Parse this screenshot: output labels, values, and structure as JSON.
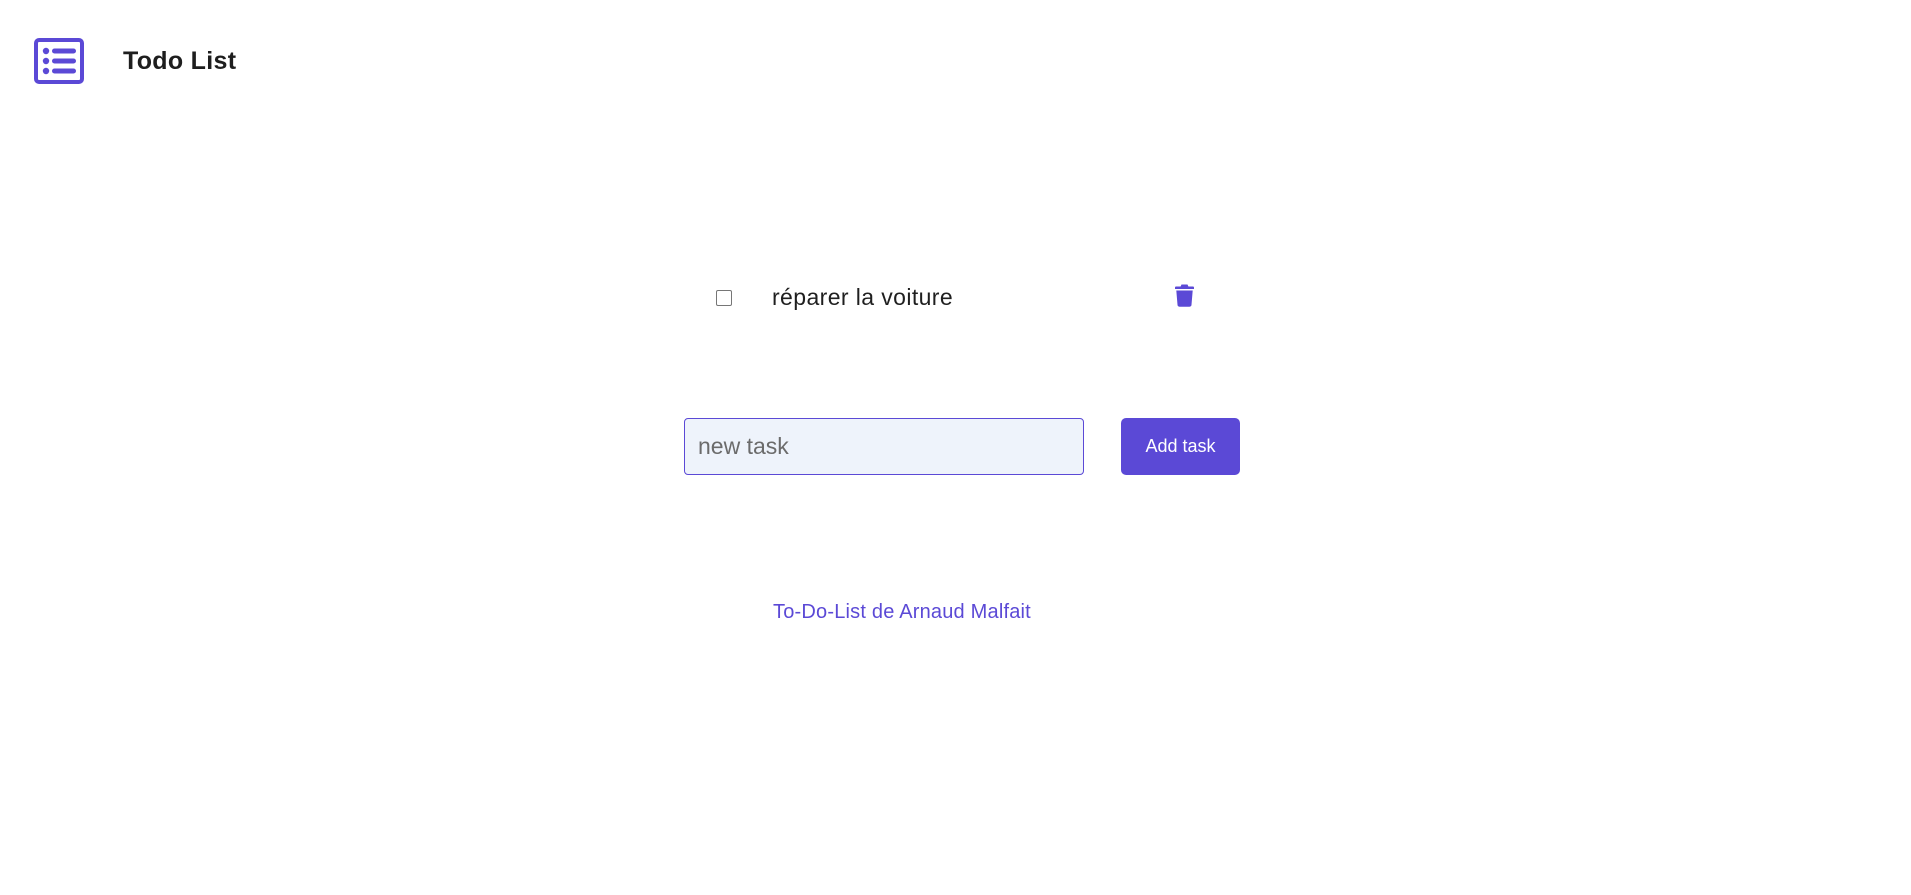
{
  "header": {
    "logo_icon": "list-icon",
    "title": "Todo List"
  },
  "tasks": [
    {
      "text": "réparer la voiture",
      "done": false,
      "delete_icon": "trash-icon"
    }
  ],
  "form": {
    "input_value": "",
    "input_placeholder": "new task",
    "add_label": "Add task"
  },
  "footer": {
    "link_text": "To-Do-List de Arnaud Malfait"
  },
  "colors": {
    "accent": "#5b49d6",
    "input_background": "#eef3fb",
    "text": "#1f1f1f",
    "background": "#ffffff"
  }
}
